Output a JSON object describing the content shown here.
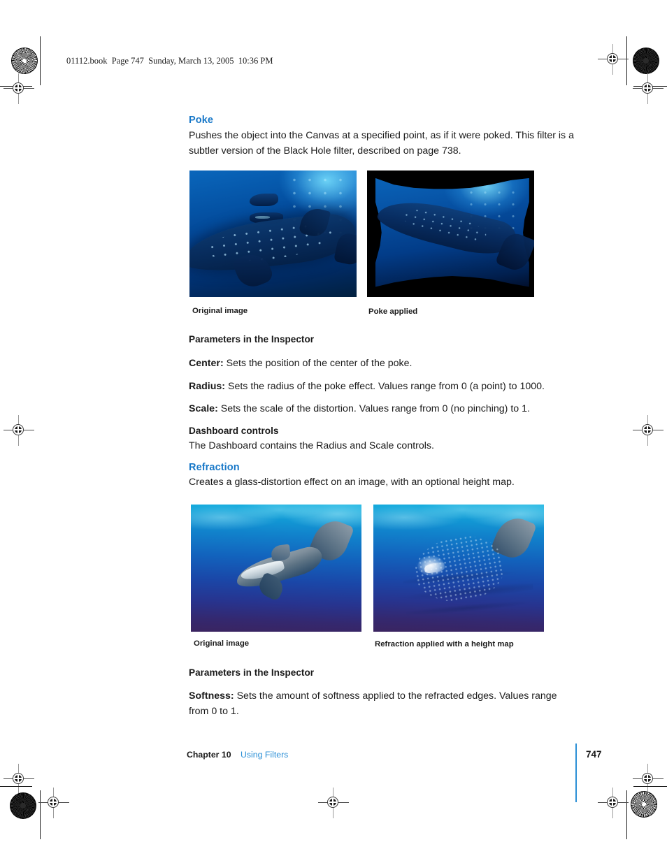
{
  "print_slug": "01112.book  Page 747  Sunday, March 13, 2005  10:36 PM",
  "sections": [
    {
      "id": "poke",
      "heading": "Poke",
      "intro": "Pushes the object into the Canvas at a specified point, as if it were poked. This filter is a subtler version of the Black Hole filter, described on page 738.",
      "figures": [
        {
          "caption": "Original image",
          "alt": "whale-shark-underwater-original"
        },
        {
          "caption": "Poke applied",
          "alt": "whale-shark-poke-distorted"
        }
      ],
      "parameters_heading": "Parameters in the Inspector",
      "parameters": [
        {
          "name": "Center:",
          "description": "Sets the position of the center of the poke."
        },
        {
          "name": "Radius:",
          "description": "Sets the radius of the poke effect. Values range from 0 (a point) to 1000."
        },
        {
          "name": "Scale:",
          "description": "Sets the scale of the distortion. Values range from 0 (no pinching) to 1."
        }
      ],
      "dashboard_heading": "Dashboard controls",
      "dashboard_text": "The Dashboard contains the Radius and Scale controls."
    },
    {
      "id": "refraction",
      "heading": "Refraction",
      "intro": "Creates a glass-distortion effect on an image, with an optional height map.",
      "figures": [
        {
          "caption": "Original image",
          "alt": "reef-shark-underwater-original"
        },
        {
          "caption": "Refraction applied with a height map",
          "alt": "reef-shark-refraction-applied"
        }
      ],
      "parameters_heading": "Parameters in the Inspector",
      "parameters": [
        {
          "name": "Softness:",
          "description": "Sets the amount of softness applied to the refracted edges. Values range from 0 to 1."
        }
      ]
    }
  ],
  "footer": {
    "chapter": "Chapter 10",
    "title": "Using Filters",
    "page_number": "747"
  },
  "colors": {
    "heading_blue": "#1878c8",
    "footer_blue": "#2b8fd6",
    "body_text": "#1a1a1a"
  }
}
